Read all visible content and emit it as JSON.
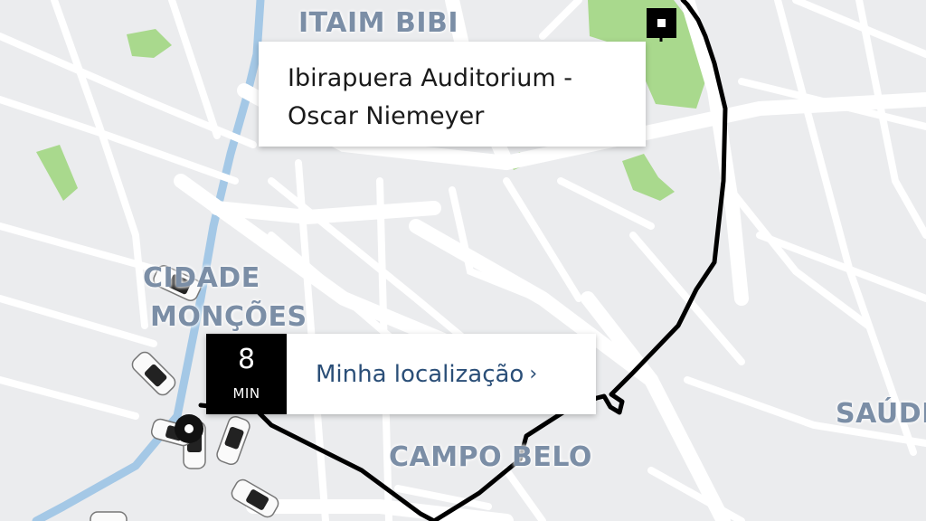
{
  "map": {
    "districts": [
      "ITAIM BIBI",
      "CIDADE",
      "MONÇÕES",
      "CAMPO BELO",
      "SAÚDE"
    ],
    "colors": {
      "background": "#ebecee",
      "road": "#ffffff",
      "park": "#a9d98d",
      "water": "#a4c8e6",
      "route": "#000000",
      "district_label": "#7b8ea6"
    }
  },
  "destination": {
    "name": "Ibirapuera Auditorium - Oscar Niemeyer",
    "marker_icon": "destination-square-icon"
  },
  "origin": {
    "eta_value": "8",
    "eta_unit": "MIN",
    "label": "Minha localização",
    "chevron": "›",
    "marker_icon": "pickup-pin-icon"
  },
  "vehicles": {
    "count": 7,
    "icon": "car-icon"
  }
}
